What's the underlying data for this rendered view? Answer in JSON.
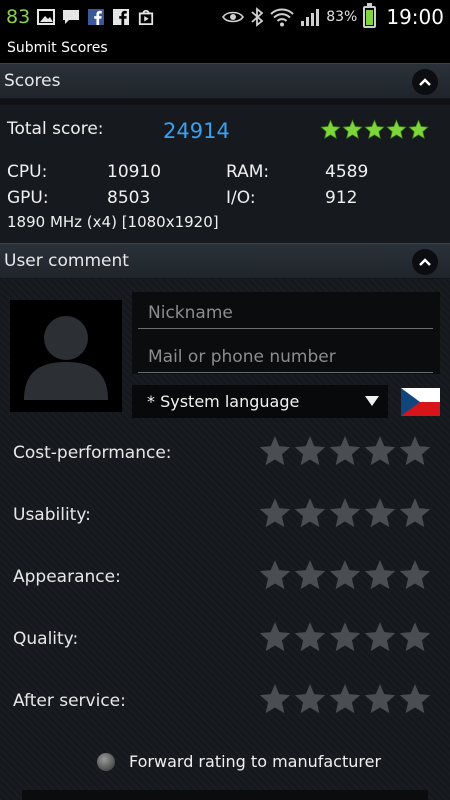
{
  "status_bar": {
    "notification_count": "83",
    "battery_percent": "83%",
    "time": "19:00",
    "icons": [
      "image-icon",
      "chat-icon",
      "facebook-icon",
      "facebook-icon",
      "play-store-icon",
      "eye-icon",
      "bluetooth-icon",
      "wifi-icon",
      "signal-icon",
      "battery-icon"
    ]
  },
  "app_bar": {
    "title": "Submit Scores"
  },
  "scores_section": {
    "title": "Scores",
    "total_label": "Total score:",
    "total_value": "24914",
    "total_stars": 5,
    "cpu_label": "CPU:",
    "cpu_value": "10910",
    "ram_label": "RAM:",
    "ram_value": "4589",
    "gpu_label": "GPU:",
    "gpu_value": "8503",
    "io_label": "I/O:",
    "io_value": "912",
    "device_info": "1890 MHz (x4) [1080x1920]"
  },
  "comment_section": {
    "title": "User comment",
    "nickname_placeholder": "Nickname",
    "contact_placeholder": "Mail or phone number",
    "language_selected": "* System language",
    "ratings": [
      {
        "label": "Cost-performance:",
        "stars": 0
      },
      {
        "label": "Usability:",
        "stars": 0
      },
      {
        "label": "Appearance:",
        "stars": 0
      },
      {
        "label": "Quality:",
        "stars": 0
      },
      {
        "label": "After service:",
        "stars": 0
      }
    ],
    "forward_label": "Forward rating to manufacturer",
    "forward_checked": false
  },
  "colors": {
    "accent_blue": "#3aa0f0",
    "star_green": "#7fd63c",
    "star_empty": "#4a4d52",
    "background": "#15181c"
  }
}
